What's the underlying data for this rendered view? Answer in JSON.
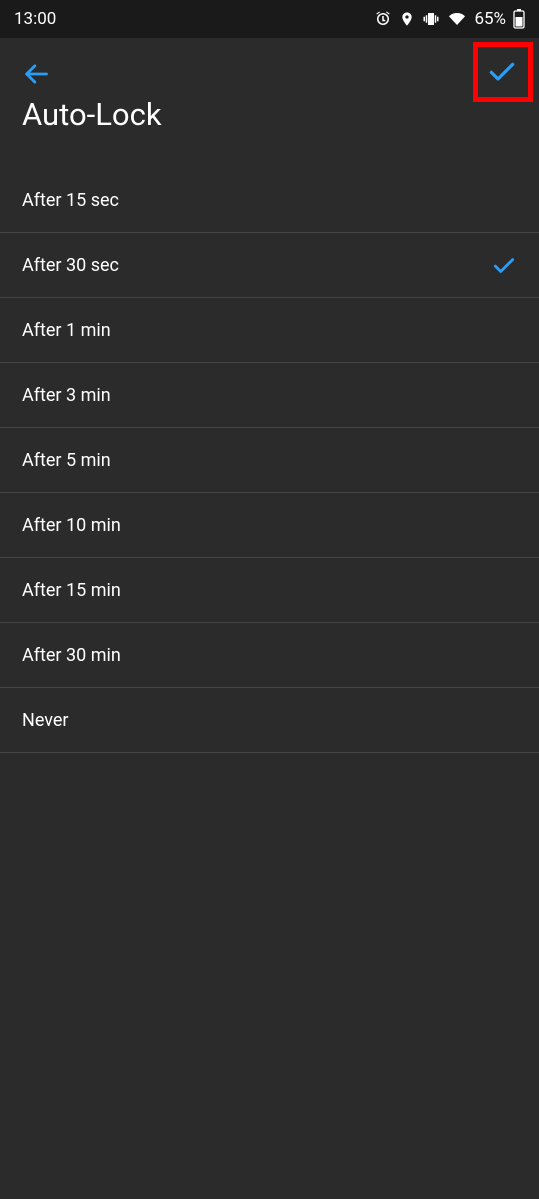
{
  "status": {
    "time": "13:00",
    "battery_pct": "65%"
  },
  "header": {
    "title": "Auto-Lock"
  },
  "options": [
    {
      "label": "After 15 sec",
      "selected": false
    },
    {
      "label": "After 30 sec",
      "selected": true
    },
    {
      "label": "After 1 min",
      "selected": false
    },
    {
      "label": "After 3 min",
      "selected": false
    },
    {
      "label": "After 5 min",
      "selected": false
    },
    {
      "label": "After 10 min",
      "selected": false
    },
    {
      "label": "After 15 min",
      "selected": false
    },
    {
      "label": "After 30 min",
      "selected": false
    },
    {
      "label": "Never",
      "selected": false
    }
  ],
  "colors": {
    "accent": "#2a9df4"
  }
}
